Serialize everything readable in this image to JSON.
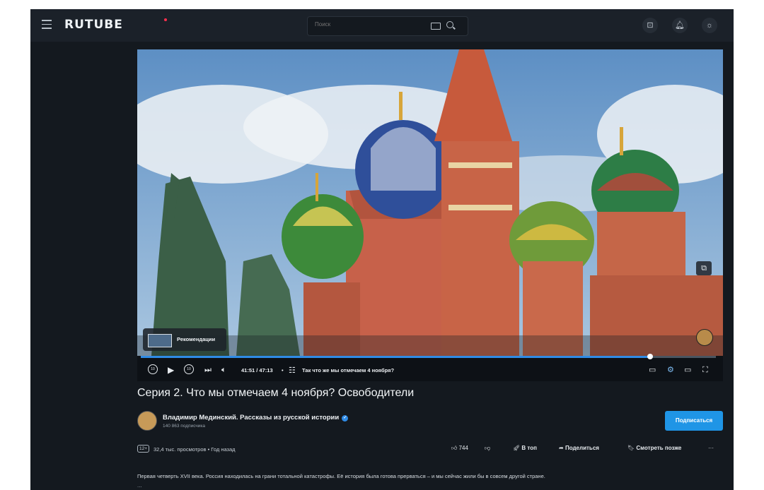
{
  "header": {
    "logo": "RUTUBE",
    "search_placeholder": "Поиск",
    "icons": [
      "menu-icon",
      "keyboard-icon",
      "search-icon",
      "upload-icon",
      "bell-icon",
      "theme-icon"
    ]
  },
  "player": {
    "recommendations_label": "Рекомендации",
    "time": "41:51 / 47:13",
    "chapter_separator": "•",
    "chapter": "Так что же мы отмечаем 4 ноября?",
    "progress_fraction": 0.886,
    "colors": {
      "progress": "#2f8be6",
      "track": "#4a5560"
    }
  },
  "video": {
    "title": "Серия 2. Что мы отмечаем 4 ноября? Освободители",
    "age_rating": "12+",
    "meta": "32,4 тыс. просмотров • Год назад",
    "description": "Первая четверть XVII века. Россия находилась на грани тотальной катастрофы. Её история была готова прерваться – и мы сейчас жили бы в совсем другой стране.",
    "more": "..."
  },
  "channel": {
    "name": "Владимир Мединский. Рассказы из русской истории",
    "subscribers": "140 863 подписчика",
    "subscribe_label": "Подписаться",
    "accent": "#1f95e6"
  },
  "actions": {
    "likes": "744",
    "top_label": "В топ",
    "share_label": "Поделиться",
    "watch_later_label": "Смотреть позже",
    "more_label": "···"
  }
}
